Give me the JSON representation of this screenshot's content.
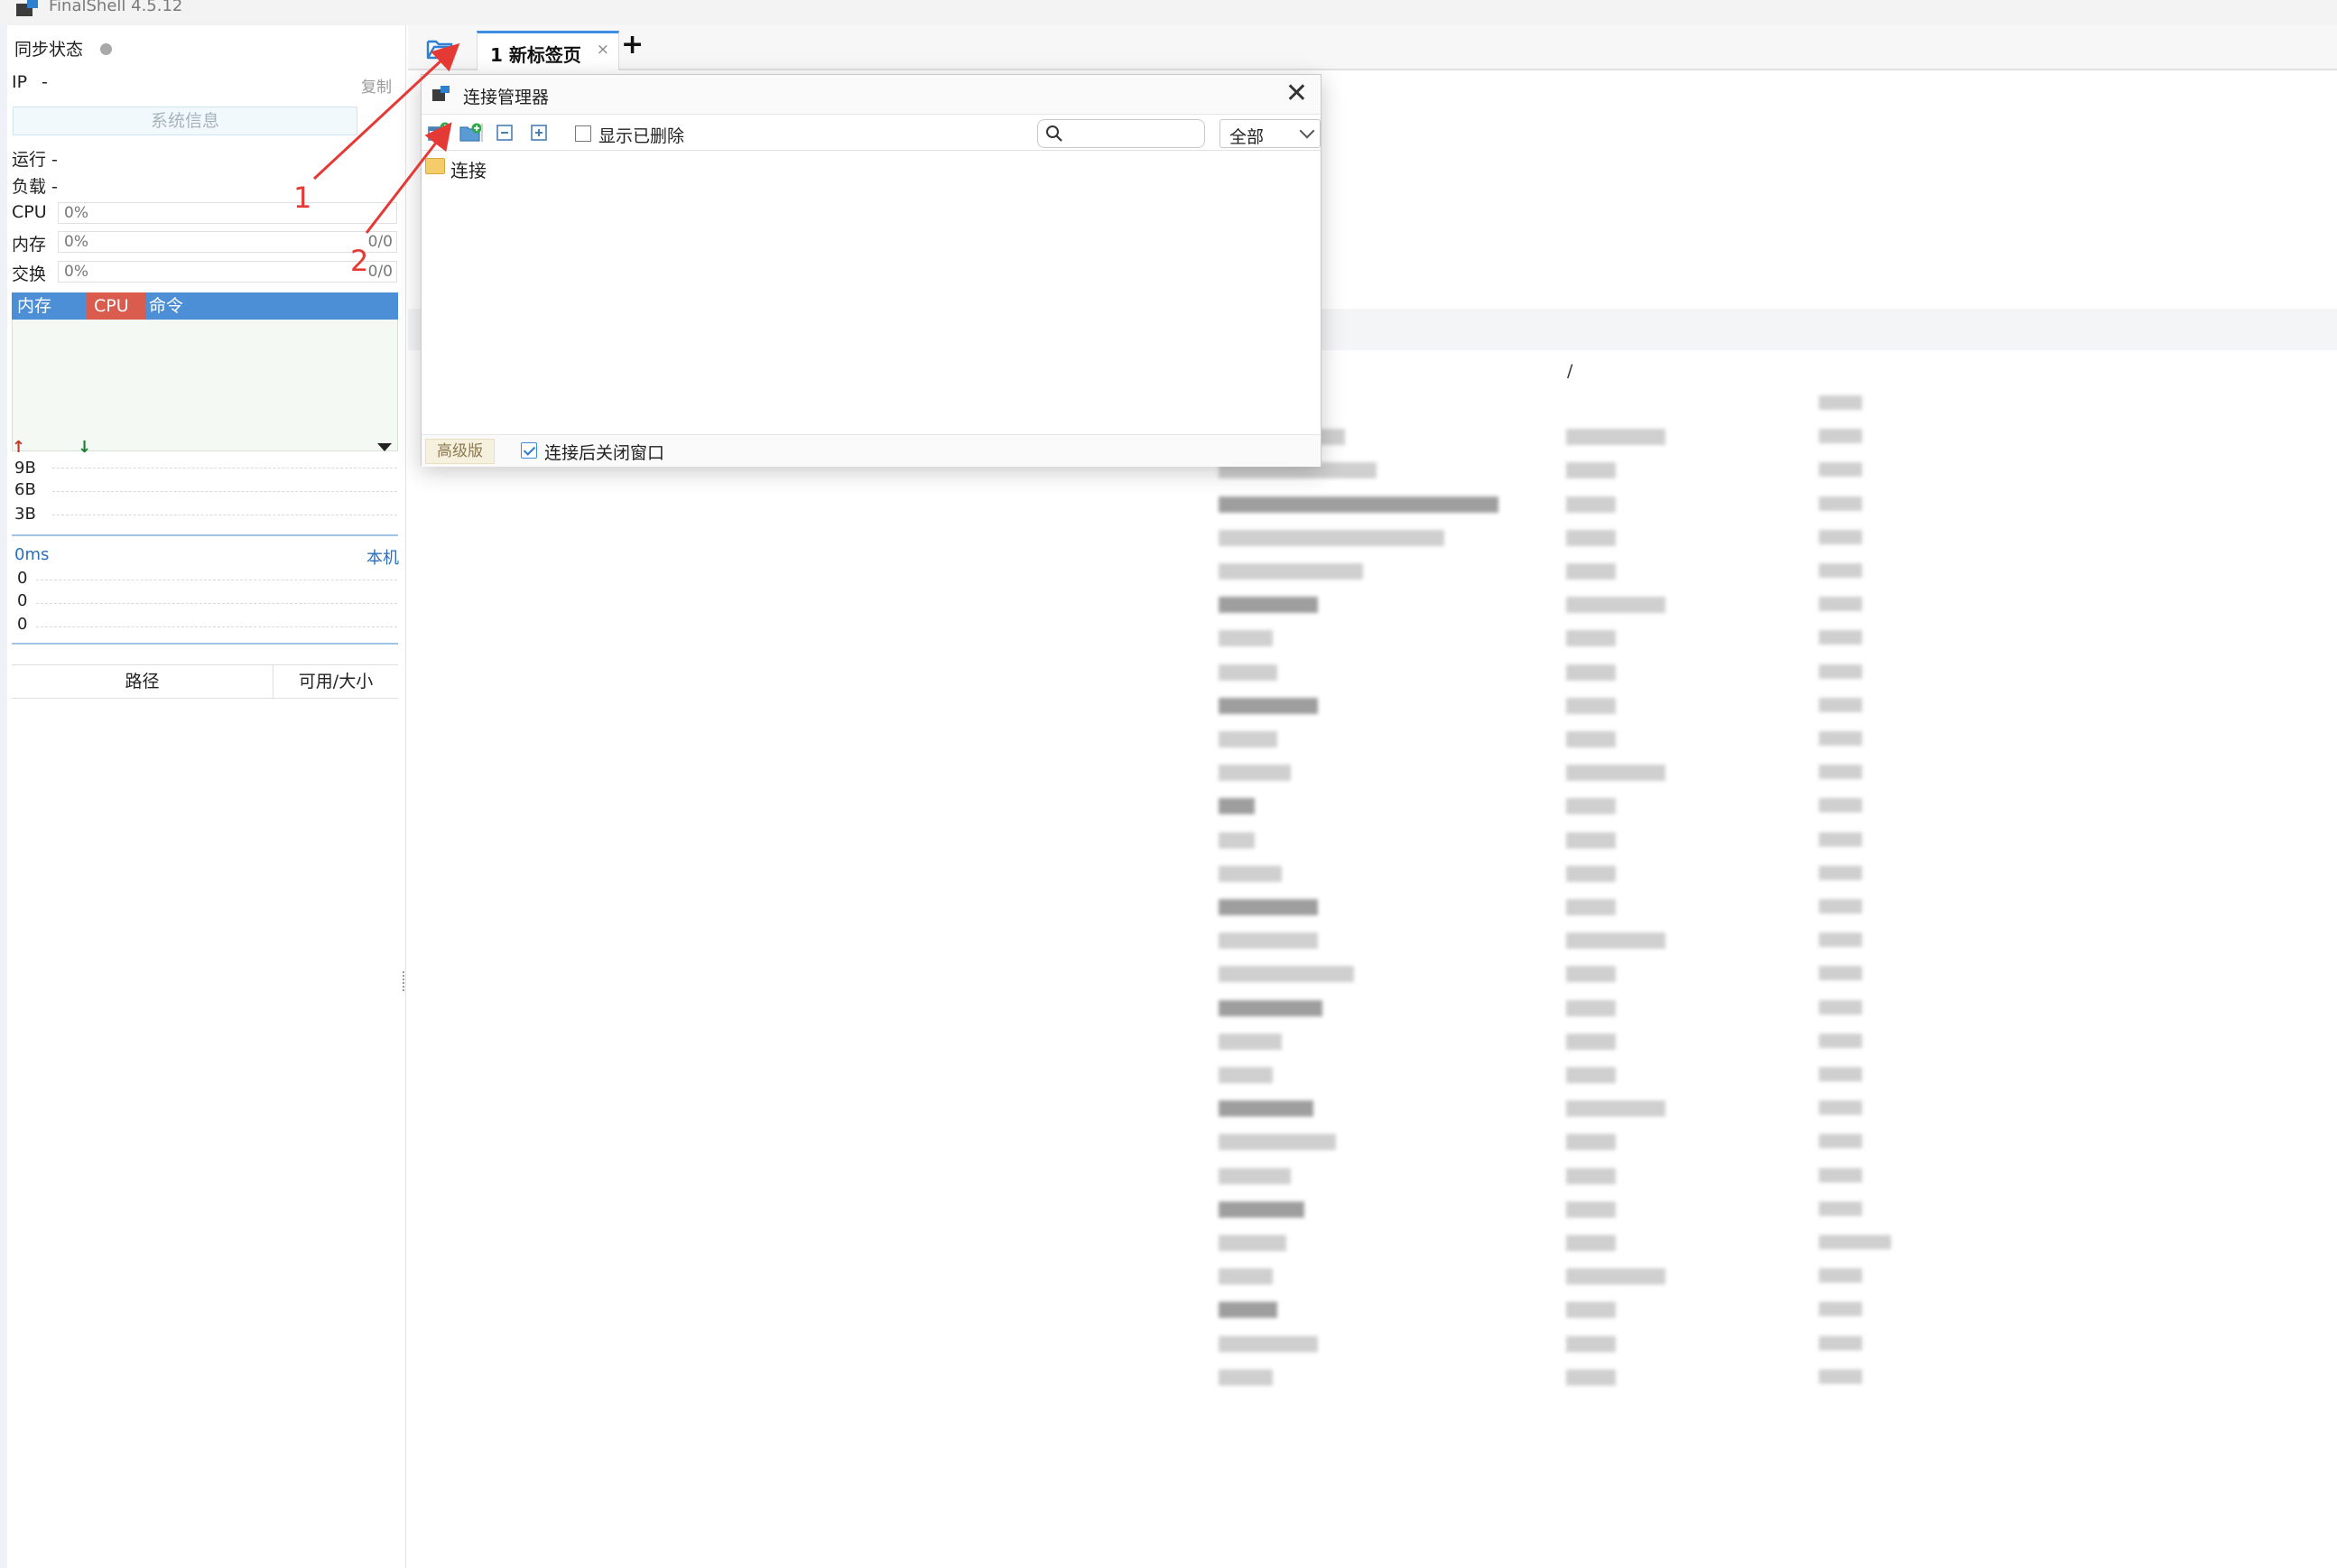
{
  "app": {
    "title": "FinalShell 4.5.12"
  },
  "left_panel": {
    "sync_label": "同步状态",
    "ip_label": "IP",
    "ip_value": "-",
    "copy_label": "复制",
    "sysinfo_button": "系统信息",
    "uptime": "运行 -",
    "load": "负载 -",
    "cpu_label": "CPU",
    "cpu_value": "0%",
    "mem_label": "内存",
    "mem_value": "0%",
    "mem_total": "0/0",
    "swap_label": "交换",
    "swap_value": "0%",
    "swap_total": "0/0",
    "proc_columns": [
      "内存",
      "CPU",
      "命令"
    ],
    "net_ticks": [
      "9B",
      "6B",
      "3B"
    ],
    "latency_label": "0ms",
    "latency_host": "本机",
    "latency_ticks": [
      "0",
      "0",
      "0"
    ],
    "disk_columns": [
      "路径",
      "可用/大小"
    ]
  },
  "tabs": [
    {
      "label": "1 新标签页",
      "close": "×"
    }
  ],
  "tab_add": "+",
  "dialog": {
    "title": "连接管理器",
    "close": "✕",
    "show_deleted": "显示已删除",
    "search": {
      "placeholder": "",
      "value": ""
    },
    "filter": "全部",
    "tree": [
      {
        "label": "连接",
        "type": "folder"
      }
    ],
    "pro_badge": "高级版",
    "close_after_connect": "连接后关闭窗口",
    "close_after_connect_checked": true
  },
  "background_listing": {
    "slash_glyph": "/"
  },
  "annotations": [
    {
      "label": "1"
    },
    {
      "label": "2"
    }
  ],
  "colors": {
    "accent": "#3a8de0",
    "cpu_header": "#d95c4f",
    "mem_header": "#4d8fd6",
    "annotation": "#e53935"
  }
}
